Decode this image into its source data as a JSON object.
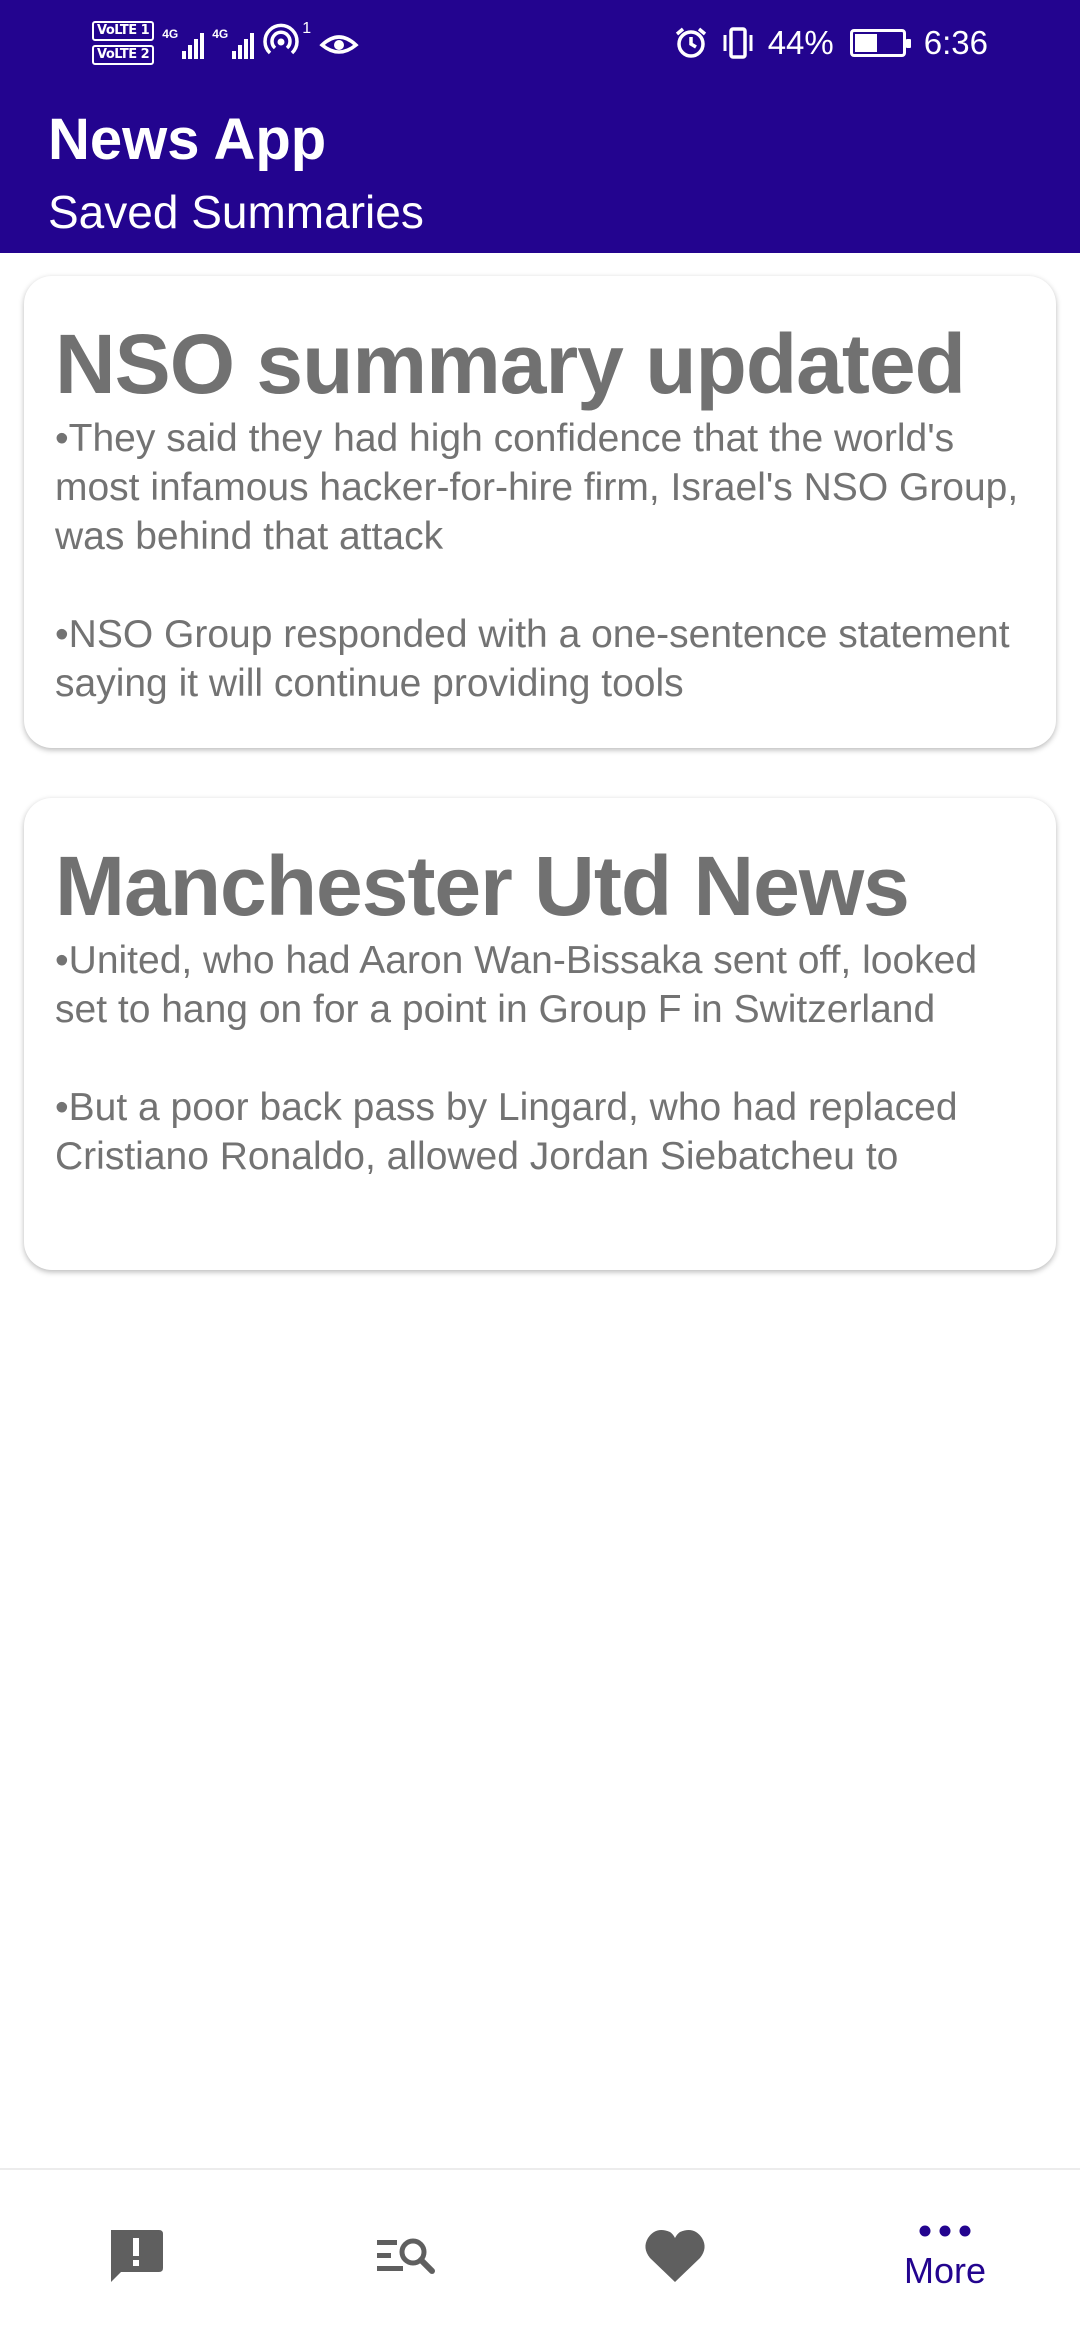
{
  "status_bar": {
    "sim1": "VoLTE 1",
    "sim2": "VoLTE 2",
    "network1": "4G",
    "network2": "4G",
    "hotspot_count": "1",
    "battery_percent": "44%",
    "battery_level": 0.44,
    "time": "6:36",
    "icons": [
      "volte-icon",
      "signal-icon",
      "hotspot-icon",
      "eye-icon",
      "alarm-icon",
      "vibrate-icon",
      "battery-charging-icon"
    ]
  },
  "header": {
    "app_title": "News App",
    "subtitle": "Saved Summaries",
    "color": "#23048f"
  },
  "cards": [
    {
      "title": "NSO summary updated",
      "points": [
        "•They said they had high confidence that the world's most infamous hacker-for-hire firm, Israel's NSO Group, was behind that attack",
        "•NSO Group responded with a one-sentence statement saying it will continue providing tools"
      ]
    },
    {
      "title": "Manchester Utd News",
      "points": [
        "•United, who had Aaron Wan-Bissaka sent off, looked set to hang on for a point in Group F in Switzerland",
        "•But a poor back pass by Lingard, who had replaced Cristiano Ronaldo, allowed Jordan Siebatcheu to"
      ]
    }
  ],
  "bottom_nav": {
    "items": [
      {
        "icon": "alert-icon",
        "label": ""
      },
      {
        "icon": "search-list-icon",
        "label": ""
      },
      {
        "icon": "heart-icon",
        "label": ""
      },
      {
        "icon": "more-icon",
        "label": "More",
        "selected": true
      }
    ],
    "inactive_color": "#5f5f5f",
    "active_color": "#23048f"
  }
}
